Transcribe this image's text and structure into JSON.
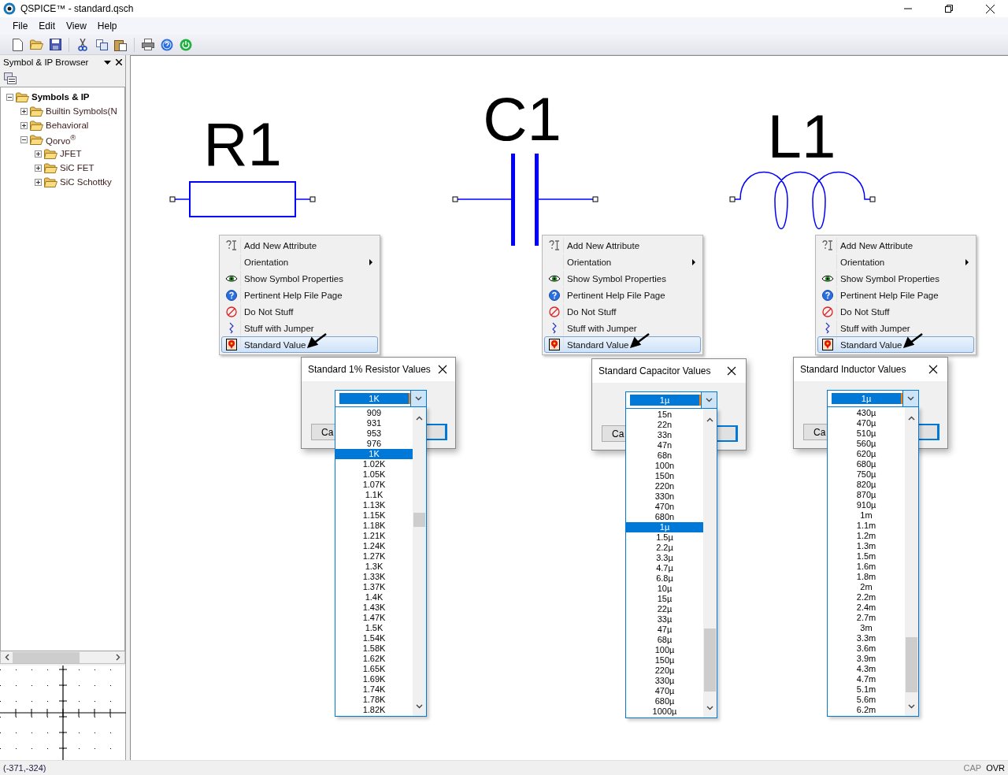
{
  "window": {
    "title": "QSPICE™ - standard.qsch"
  },
  "menu_bar": [
    "File",
    "Edit",
    "View",
    "Help"
  ],
  "sidebar": {
    "title": "Symbol & IP Browser",
    "tree": [
      {
        "label": "Symbols & IP",
        "expanded": true,
        "children": [
          {
            "label": "Builtin Symbols(N",
            "expanded": false
          },
          {
            "label": "Behavioral",
            "expanded": false
          },
          {
            "label": "Qorvo$^{®}$",
            "expanded": true,
            "children": [
              {
                "label": "JFET",
                "expanded": false
              },
              {
                "label": "SiC FET",
                "expanded": false
              },
              {
                "label": "SiC Schottky",
                "expanded": false
              }
            ]
          }
        ]
      }
    ]
  },
  "components": [
    {
      "designator": "R1",
      "kind": "resistor",
      "context_menu": [
        {
          "label": "Add New Attribute",
          "submenu": false,
          "selected": false
        },
        {
          "label": "Orientation",
          "submenu": true,
          "selected": false
        },
        {
          "label": "Show Symbol Properties",
          "submenu": false,
          "selected": false
        },
        {
          "label": "Pertinent Help File Page",
          "submenu": false,
          "selected": false
        },
        {
          "label": "Do Not Stuff",
          "submenu": false,
          "selected": false
        },
        {
          "label": "Stuff with Jumper",
          "submenu": false,
          "selected": false
        },
        {
          "label": "Standard Value",
          "submenu": false,
          "selected": true
        }
      ],
      "dialog": {
        "title": "Standard 1% Resistor Values",
        "value": "1K",
        "button": "Ca",
        "options": [
          {
            "label": "909",
            "selected": false
          },
          {
            "label": "931",
            "selected": false
          },
          {
            "label": "953",
            "selected": false
          },
          {
            "label": "976",
            "selected": false
          },
          {
            "label": "1K",
            "selected": true
          },
          {
            "label": "1.02K",
            "selected": false
          },
          {
            "label": "1.05K",
            "selected": false
          },
          {
            "label": "1.07K",
            "selected": false
          },
          {
            "label": "1.1K",
            "selected": false
          },
          {
            "label": "1.13K",
            "selected": false
          },
          {
            "label": "1.15K",
            "selected": false
          },
          {
            "label": "1.18K",
            "selected": false
          },
          {
            "label": "1.21K",
            "selected": false
          },
          {
            "label": "1.24K",
            "selected": false
          },
          {
            "label": "1.27K",
            "selected": false
          },
          {
            "label": "1.3K",
            "selected": false
          },
          {
            "label": "1.33K",
            "selected": false
          },
          {
            "label": "1.37K",
            "selected": false
          },
          {
            "label": "1.4K",
            "selected": false
          },
          {
            "label": "1.43K",
            "selected": false
          },
          {
            "label": "1.47K",
            "selected": false
          },
          {
            "label": "1.5K",
            "selected": false
          },
          {
            "label": "1.54K",
            "selected": false
          },
          {
            "label": "1.58K",
            "selected": false
          },
          {
            "label": "1.62K",
            "selected": false
          },
          {
            "label": "1.65K",
            "selected": false
          },
          {
            "label": "1.69K",
            "selected": false
          },
          {
            "label": "1.74K",
            "selected": false
          },
          {
            "label": "1.78K",
            "selected": false
          },
          {
            "label": "1.82K",
            "selected": false
          }
        ]
      }
    },
    {
      "designator": "C1",
      "kind": "capacitor",
      "context_menu": [
        {
          "label": "Add New Attribute",
          "submenu": false,
          "selected": false
        },
        {
          "label": "Orientation",
          "submenu": true,
          "selected": false
        },
        {
          "label": "Show Symbol Properties",
          "submenu": false,
          "selected": false
        },
        {
          "label": "Pertinent Help File Page",
          "submenu": false,
          "selected": false
        },
        {
          "label": "Do Not Stuff",
          "submenu": false,
          "selected": false
        },
        {
          "label": "Stuff with Jumper",
          "submenu": false,
          "selected": false
        },
        {
          "label": "Standard Value",
          "submenu": false,
          "selected": true
        }
      ],
      "dialog": {
        "title": "Standard Capacitor Values",
        "value": "1µ",
        "button": "Ca",
        "options": [
          {
            "label": "15n",
            "selected": false
          },
          {
            "label": "22n",
            "selected": false
          },
          {
            "label": "33n",
            "selected": false
          },
          {
            "label": "47n",
            "selected": false
          },
          {
            "label": "68n",
            "selected": false
          },
          {
            "label": "100n",
            "selected": false
          },
          {
            "label": "150n",
            "selected": false
          },
          {
            "label": "220n",
            "selected": false
          },
          {
            "label": "330n",
            "selected": false
          },
          {
            "label": "470n",
            "selected": false
          },
          {
            "label": "680n",
            "selected": false
          },
          {
            "label": "1µ",
            "selected": true
          },
          {
            "label": "1.5µ",
            "selected": false
          },
          {
            "label": "2.2µ",
            "selected": false
          },
          {
            "label": "3.3µ",
            "selected": false
          },
          {
            "label": "4.7µ",
            "selected": false
          },
          {
            "label": "6.8µ",
            "selected": false
          },
          {
            "label": "10µ",
            "selected": false
          },
          {
            "label": "15µ",
            "selected": false
          },
          {
            "label": "22µ",
            "selected": false
          },
          {
            "label": "33µ",
            "selected": false
          },
          {
            "label": "47µ",
            "selected": false
          },
          {
            "label": "68µ",
            "selected": false
          },
          {
            "label": "100µ",
            "selected": false
          },
          {
            "label": "150µ",
            "selected": false
          },
          {
            "label": "220µ",
            "selected": false
          },
          {
            "label": "330µ",
            "selected": false
          },
          {
            "label": "470µ",
            "selected": false
          },
          {
            "label": "680µ",
            "selected": false
          },
          {
            "label": "1000µ",
            "selected": false
          }
        ]
      }
    },
    {
      "designator": "L1",
      "kind": "inductor",
      "context_menu": [
        {
          "label": "Add New Attribute",
          "submenu": false,
          "selected": false
        },
        {
          "label": "Orientation",
          "submenu": true,
          "selected": false
        },
        {
          "label": "Show Symbol Properties",
          "submenu": false,
          "selected": false
        },
        {
          "label": "Pertinent Help File Page",
          "submenu": false,
          "selected": false
        },
        {
          "label": "Do Not Stuff",
          "submenu": false,
          "selected": false
        },
        {
          "label": "Stuff with Jumper",
          "submenu": false,
          "selected": false
        },
        {
          "label": "Standard Value",
          "submenu": false,
          "selected": true
        }
      ],
      "dialog": {
        "title": "Standard Inductor Values",
        "value": "1µ",
        "button": "Ca",
        "options": [
          {
            "label": "430µ",
            "selected": false
          },
          {
            "label": "470µ",
            "selected": false
          },
          {
            "label": "510µ",
            "selected": false
          },
          {
            "label": "560µ",
            "selected": false
          },
          {
            "label": "620µ",
            "selected": false
          },
          {
            "label": "680µ",
            "selected": false
          },
          {
            "label": "750µ",
            "selected": false
          },
          {
            "label": "820µ",
            "selected": false
          },
          {
            "label": "870µ",
            "selected": false
          },
          {
            "label": "910µ",
            "selected": false
          },
          {
            "label": "1m",
            "selected": false
          },
          {
            "label": "1.1m",
            "selected": false
          },
          {
            "label": "1.2m",
            "selected": false
          },
          {
            "label": "1.3m",
            "selected": false
          },
          {
            "label": "1.5m",
            "selected": false
          },
          {
            "label": "1.6m",
            "selected": false
          },
          {
            "label": "1.8m",
            "selected": false
          },
          {
            "label": "2m",
            "selected": false
          },
          {
            "label": "2.2m",
            "selected": false
          },
          {
            "label": "2.4m",
            "selected": false
          },
          {
            "label": "2.7m",
            "selected": false
          },
          {
            "label": "3m",
            "selected": false
          },
          {
            "label": "3.3m",
            "selected": false
          },
          {
            "label": "3.6m",
            "selected": false
          },
          {
            "label": "3.9m",
            "selected": false
          },
          {
            "label": "4.3m",
            "selected": false
          },
          {
            "label": "4.7m",
            "selected": false
          },
          {
            "label": "5.1m",
            "selected": false
          },
          {
            "label": "5.6m",
            "selected": false
          },
          {
            "label": "6.2m",
            "selected": false
          }
        ]
      }
    }
  ],
  "status_bar": {
    "coordinates": "(-371,-324)",
    "indicators": [
      {
        "label": "CAP",
        "on": false
      },
      {
        "label": "OVR",
        "on": true
      }
    ]
  }
}
